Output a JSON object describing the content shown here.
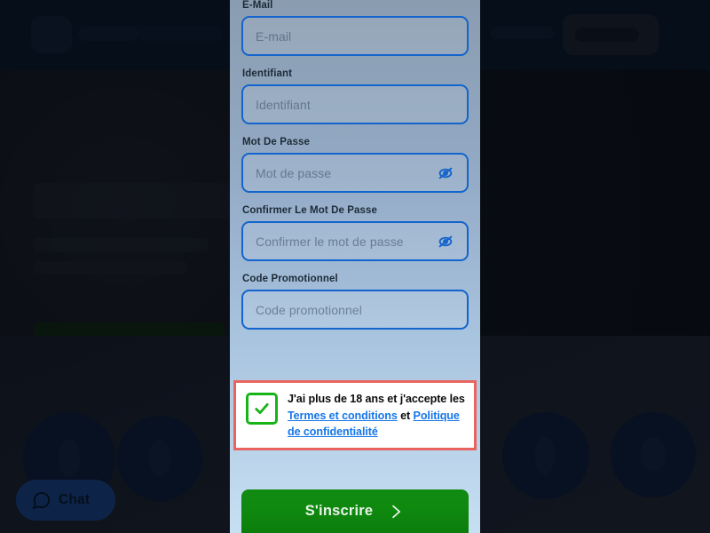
{
  "background": {
    "navbar": {
      "logo_icon": "brand-logo-icon",
      "menu_placeholder_a": "",
      "menu_placeholder_b": "",
      "menu_placeholder_c": "",
      "account_button_label": ""
    },
    "hero": {
      "title": "",
      "subtitle_line_1": "",
      "subtitle_line_2": "",
      "cta_label": ""
    },
    "chat_widget": {
      "label": "Chat",
      "icon": "chat-bubble-icon",
      "color": "#1d54a5"
    }
  },
  "modal": {
    "fields": [
      {
        "label": "E-Mail",
        "placeholder": "E-mail",
        "value": "",
        "name": "email",
        "has_toggle": false
      },
      {
        "label": "Identifiant",
        "placeholder": "Identifiant",
        "value": "",
        "name": "username",
        "has_toggle": false
      },
      {
        "label": "Mot De Passe",
        "placeholder": "Mot de passe",
        "value": "",
        "name": "password",
        "has_toggle": true,
        "toggle_icon": "eye-slash-icon"
      },
      {
        "label": "Confirmer Le Mot De Passe",
        "placeholder": "Confirmer le mot de passe",
        "value": "",
        "name": "confirm-password",
        "has_toggle": true,
        "toggle_icon": "eye-slash-icon"
      },
      {
        "label": "Code Promotionnel",
        "placeholder": "Code promotionnel",
        "value": "",
        "name": "promo-code",
        "has_toggle": false
      }
    ],
    "consent": {
      "checked": true,
      "checkbox_icon": "checkmark-icon",
      "text_part_1": "J'ai plus de 18 ans et j'accepte les ",
      "link_terms": "Termes et conditions",
      "text_part_2": " et ",
      "link_privacy": "Politique de confidentialité",
      "highlight_border_color": "#e8655f",
      "checkbox_color": "#17b417",
      "link_color": "#1676e8"
    },
    "submit": {
      "label": "S'inscrire",
      "chevron_icon": "chevron-right-icon",
      "color": "#0f8a0f"
    }
  }
}
